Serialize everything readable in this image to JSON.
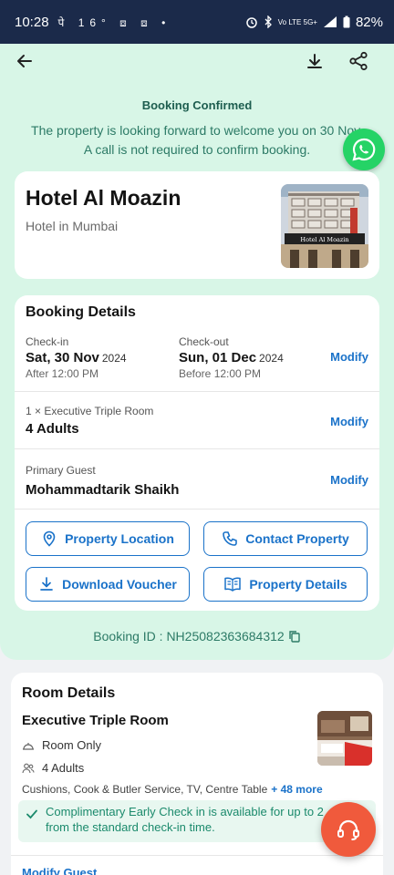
{
  "status_bar": {
    "time": "10:28",
    "notifications": "पे 16° ⧈ ⧈ •",
    "network": "Vo LTE 5G+",
    "battery": "82%"
  },
  "icons": {
    "back": "arrow-left-icon",
    "download": "download-icon",
    "share": "share-icon",
    "whatsapp": "whatsapp-icon",
    "support": "headset-icon"
  },
  "confirmation": {
    "title": "Booking Confirmed",
    "line1": "The property is looking forward to welcome you on 30 Nov.",
    "line2": "A call is not required to confirm booking."
  },
  "hotel": {
    "name": "Hotel Al Moazin",
    "subtitle": "Hotel in Mumbai",
    "photo_sign": "Hotel Al Moazin"
  },
  "booking": {
    "title": "Booking Details",
    "checkin_label": "Check-in",
    "checkin_date": "Sat, 30 Nov",
    "checkin_year": "2024",
    "checkin_time": "After  12:00 PM",
    "checkout_label": "Check-out",
    "checkout_date": "Sun, 01 Dec",
    "checkout_year": "2024",
    "checkout_time": "Before  12:00 PM",
    "modify_label": "Modify",
    "room_label": "1 × Executive Triple Room",
    "guests": "4 Adults",
    "guest_label": "Primary Guest",
    "guest_name": "Mohammadtarik  Shaikh",
    "buttons": {
      "location": "Property Location",
      "contact": "Contact Property",
      "voucher": "Download Voucher",
      "details": "Property Details"
    },
    "booking_id": "Booking ID : NH25082363684312"
  },
  "room": {
    "title": "Room Details",
    "name": "Executive Triple Room",
    "meal": "Room Only",
    "occupancy": "4 Adults",
    "amenities": "Cushions, Cook & Butler Service, TV, Centre Table",
    "more": "+ 48 more",
    "early_checkin": "Complimentary Early Check in is available for up to 2\nfrom the standard check-in time.",
    "modify_guest": "Modify Guest"
  },
  "colors": {
    "header_bg": "#1b2a4a",
    "hero_bg": "#d8f6e7",
    "accent": "#1a72c9",
    "confirm_text": "#2c7a66",
    "fab": "#f05a3c",
    "whatsapp": "#25d366"
  }
}
